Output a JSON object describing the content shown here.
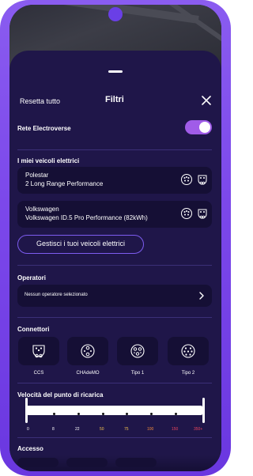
{
  "header": {
    "reset_label": "Resetta tutto",
    "title": "Filtri"
  },
  "electroverse": {
    "label": "Rete Electroverse",
    "enabled": true
  },
  "vehicles": {
    "section_label": "I miei veicoli elettrici",
    "items": [
      {
        "line1": "Polestar",
        "line2": "2 Long Range Performance"
      },
      {
        "line1": "Volkswagen",
        "line2": "Volkswagen ID.5 Pro Performance (82kWh)"
      }
    ],
    "manage_label": "Gestisci i tuoi veicoli elettrici"
  },
  "operators": {
    "section_label": "Operatori",
    "value": "Nessun operatore selezionato"
  },
  "connectors": {
    "section_label": "Connettori",
    "items": [
      {
        "label": "CCS"
      },
      {
        "label": "CHAdeMO"
      },
      {
        "label": "Tipo 1"
      },
      {
        "label": "Tipo 2"
      }
    ]
  },
  "speed": {
    "section_label": "Velocità del punto di ricarica",
    "ticks": [
      "0",
      "8",
      "22",
      "50",
      "75",
      "100",
      "150",
      "350+"
    ]
  },
  "access": {
    "section_label": "Accesso"
  },
  "colors": {
    "background": "#1f1649",
    "card": "#150f35",
    "accent": "#7d5cf0",
    "toggle_on": "#a05ce8",
    "frame": "#7b47ea",
    "tick_yellow": "#f2c14e",
    "tick_orange": "#f08a3c",
    "tick_red": "#e8455c"
  }
}
